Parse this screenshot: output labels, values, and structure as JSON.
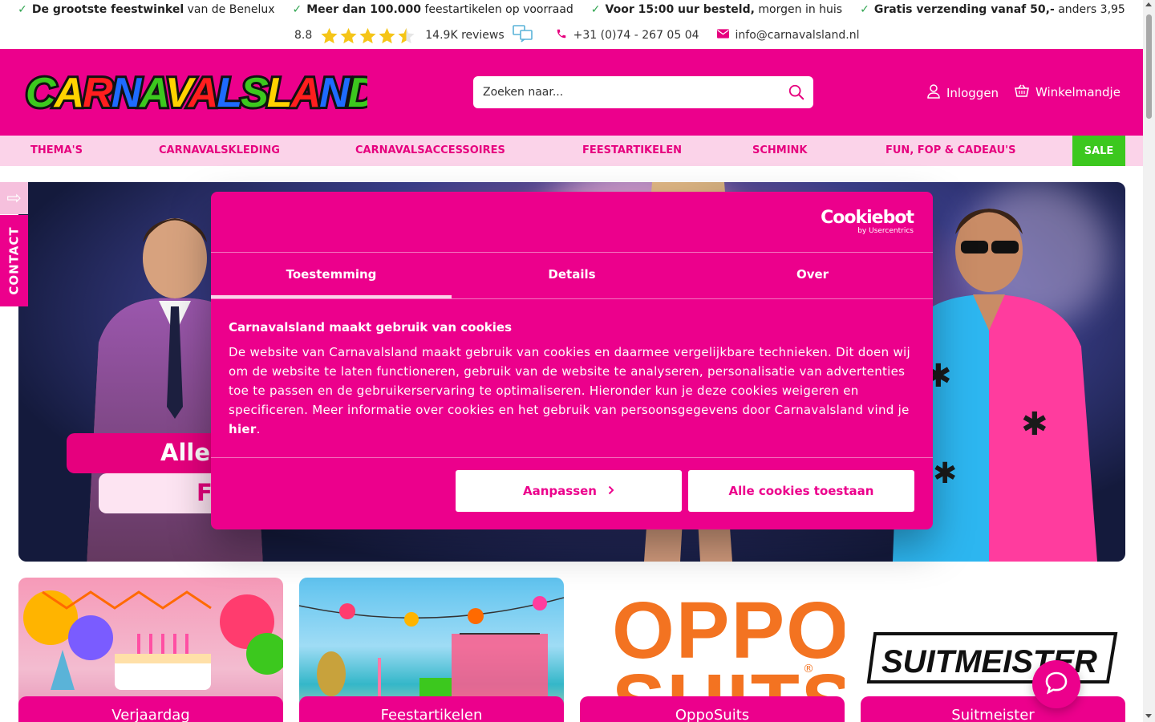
{
  "usp": [
    {
      "bold": "De grootste feestwinkel",
      "rest": " van de Benelux"
    },
    {
      "bold": "Meer dan 100.000",
      "rest": " feestartikelen op voorraad"
    },
    {
      "bold": "Voor 15:00 uur besteld,",
      "rest": " morgen in huis"
    },
    {
      "bold": "Gratis verzending vanaf 50,-",
      "rest": " anders 3,95"
    }
  ],
  "rating": {
    "score": "8.8",
    "stars": 4.5,
    "reviews": "14.9K reviews"
  },
  "contact": {
    "phone": "+31 (0)74 - 267 05 04",
    "email": "info@carnavalsland.nl"
  },
  "header": {
    "logo_text": "CARNAVALSLAND",
    "search_placeholder": "Zoeken naar...",
    "login_label": "Inloggen",
    "cart_label": "Winkelmandje"
  },
  "nav": {
    "items": [
      "THEMA'S",
      "CARNAVALSKLEDING",
      "CARNAVALSACCESSOIRES",
      "FEESTARTIKELEN",
      "SCHMINK",
      "FUN, FOP & CADEAU'S"
    ],
    "sale": "SALE"
  },
  "side_tab": {
    "label": "CONTACT"
  },
  "hero": {
    "line1": "Alles",
    "line2": "F"
  },
  "tiles": [
    "Verjaardag",
    "Feestartikelen",
    "OppoSuits",
    "Suitmeister"
  ],
  "tile_brands": {
    "opposuits_top": "OPPO",
    "opposuits_bottom": "SUITS",
    "suitmeister": "SUITMEISTER"
  },
  "cookie": {
    "brand": "Cookiebot",
    "brand_sub": "by Usercentrics",
    "tabs": [
      "Toestemming",
      "Details",
      "Over"
    ],
    "title": "Carnavalsland maakt gebruik van cookies",
    "text": "De website van Carnavalsland maakt gebruik van cookies en daarmee vergelijkbare technieken. Dit doen wij om de website te laten functioneren, gebruik van de website te analyseren, personalisatie van advertenties toe te passen en de gebruikerservaring te optimaliseren. Hieronder kun je deze cookies weigeren en specificeren. Meer informatie over cookies en het gebruik van persoonsgegevens door Carnavalsland vind je ",
    "link": "hier",
    "text_end": ".",
    "btn_customize": "Aanpassen",
    "btn_allow": "Alle cookies toestaan"
  },
  "colors": {
    "brand_pink": "#ec008c",
    "nav_bg": "#fbd3e9",
    "sale_green": "#3cc81e",
    "check_green": "#2ea44f"
  }
}
